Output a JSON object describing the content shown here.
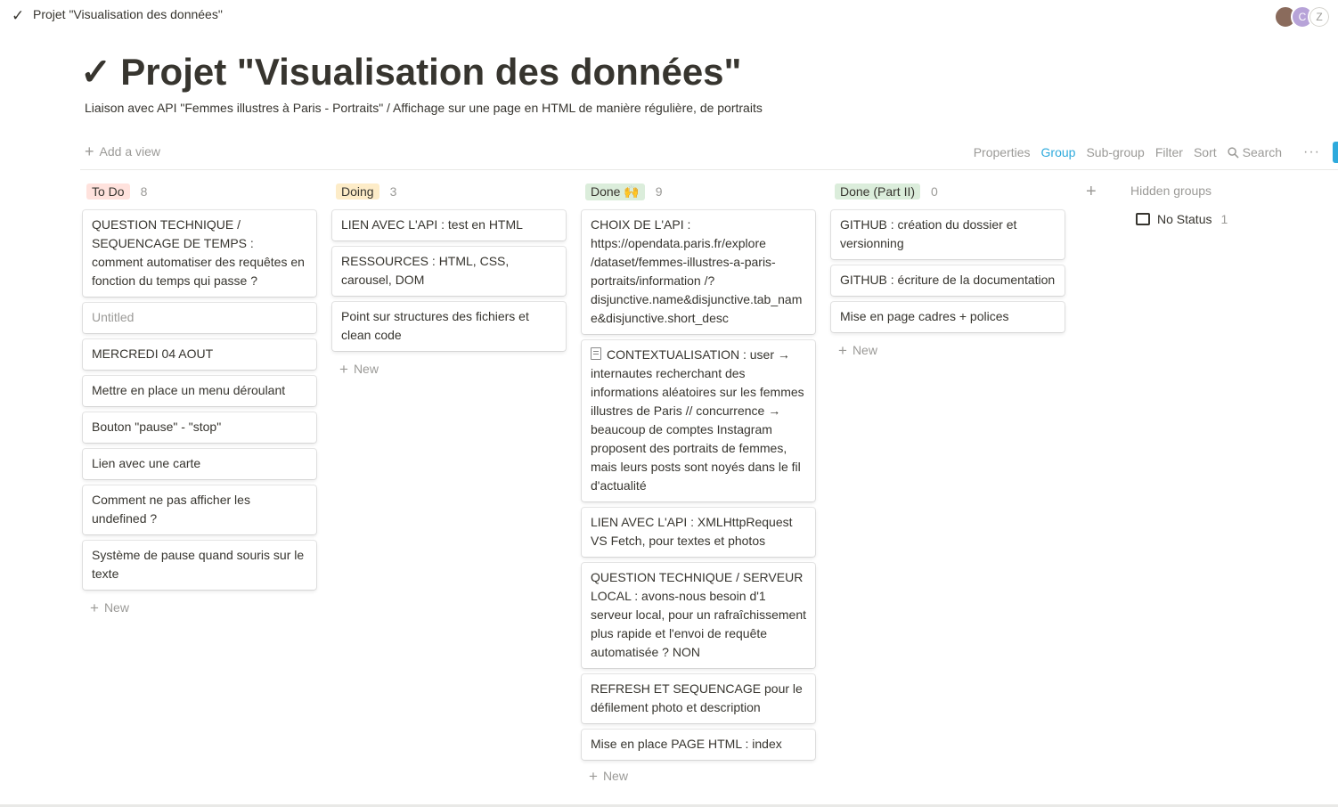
{
  "topbar": {
    "breadcrumb": "Projet \"Visualisation des données\"",
    "check_icon": "✓"
  },
  "page": {
    "title": "Projet \"Visualisation des données\"",
    "title_icon": "✓",
    "description": "Liaison avec API \"Femmes illustres à Paris - Portraits\" / Affichage sur une page en HTML de manière régulière, de portraits"
  },
  "viewbar": {
    "add_view": "Add a view",
    "properties": "Properties",
    "group": "Group",
    "subgroup": "Sub-group",
    "filter": "Filter",
    "sort": "Sort",
    "search": "Search",
    "more": "···"
  },
  "avatars": [
    "",
    "C",
    "Z"
  ],
  "columns": [
    {
      "label": "To Do",
      "count": "8",
      "color": "#ffe2dd",
      "cards": [
        "QUESTION TECHNIQUE / SEQUENCAGE DE TEMPS : comment automatiser des requêtes en fonction du temps qui passe ?",
        "Untitled",
        "MERCREDI 04 AOUT",
        "Mettre en place un menu déroulant",
        "Bouton \"pause\" - \"stop\"",
        "Lien avec une carte",
        "Comment ne pas afficher les undefined ?",
        "Système de pause quand souris sur le texte"
      ],
      "new_label": "New"
    },
    {
      "label": "Doing",
      "count": "3",
      "color": "#fdecc8",
      "cards": [
        "LIEN AVEC L'API : test en HTML",
        "RESSOURCES : HTML, CSS, carousel, DOM",
        "Point sur structures des fichiers et clean code"
      ],
      "new_label": "New"
    },
    {
      "label": "Done 🙌",
      "count": "9",
      "color": "#dbeddb",
      "cards": [
        "CHOIX DE L'API : https://opendata.paris.fr/explore /dataset/femmes-illustres-a-paris-portraits/information /?disjunctive.name&disjunctive.tab_name&disjunctive.short_desc",
        "CONTEXTUALISATION : user → internautes recherchant des informations aléatoires sur les femmes illustres de Paris // concurrence → beaucoup de comptes Instagram proposent des portraits de femmes, mais leurs posts sont noyés dans le fil d'actualité",
        "LIEN AVEC L'API : XMLHttpRequest VS Fetch, pour textes et photos",
        "QUESTION TECHNIQUE / SERVEUR LOCAL : avons-nous besoin d'1 serveur local, pour un rafraîchissement plus rapide et l'envoi de requête automatisée ? NON",
        "REFRESH ET SEQUENCAGE pour le défilement photo et description",
        "Mise en place PAGE HTML : index"
      ],
      "new_label": "New"
    },
    {
      "label": "Done (Part II)",
      "count": "0",
      "color": "#dbeddb",
      "cards": [
        "GITHUB : création du dossier et versionning",
        "GITHUB : écriture de la documentation",
        "Mise en page cadres + polices"
      ],
      "new_label": "New"
    }
  ],
  "hidden_groups": {
    "label": "Hidden groups",
    "item": "No Status",
    "count": "1"
  }
}
